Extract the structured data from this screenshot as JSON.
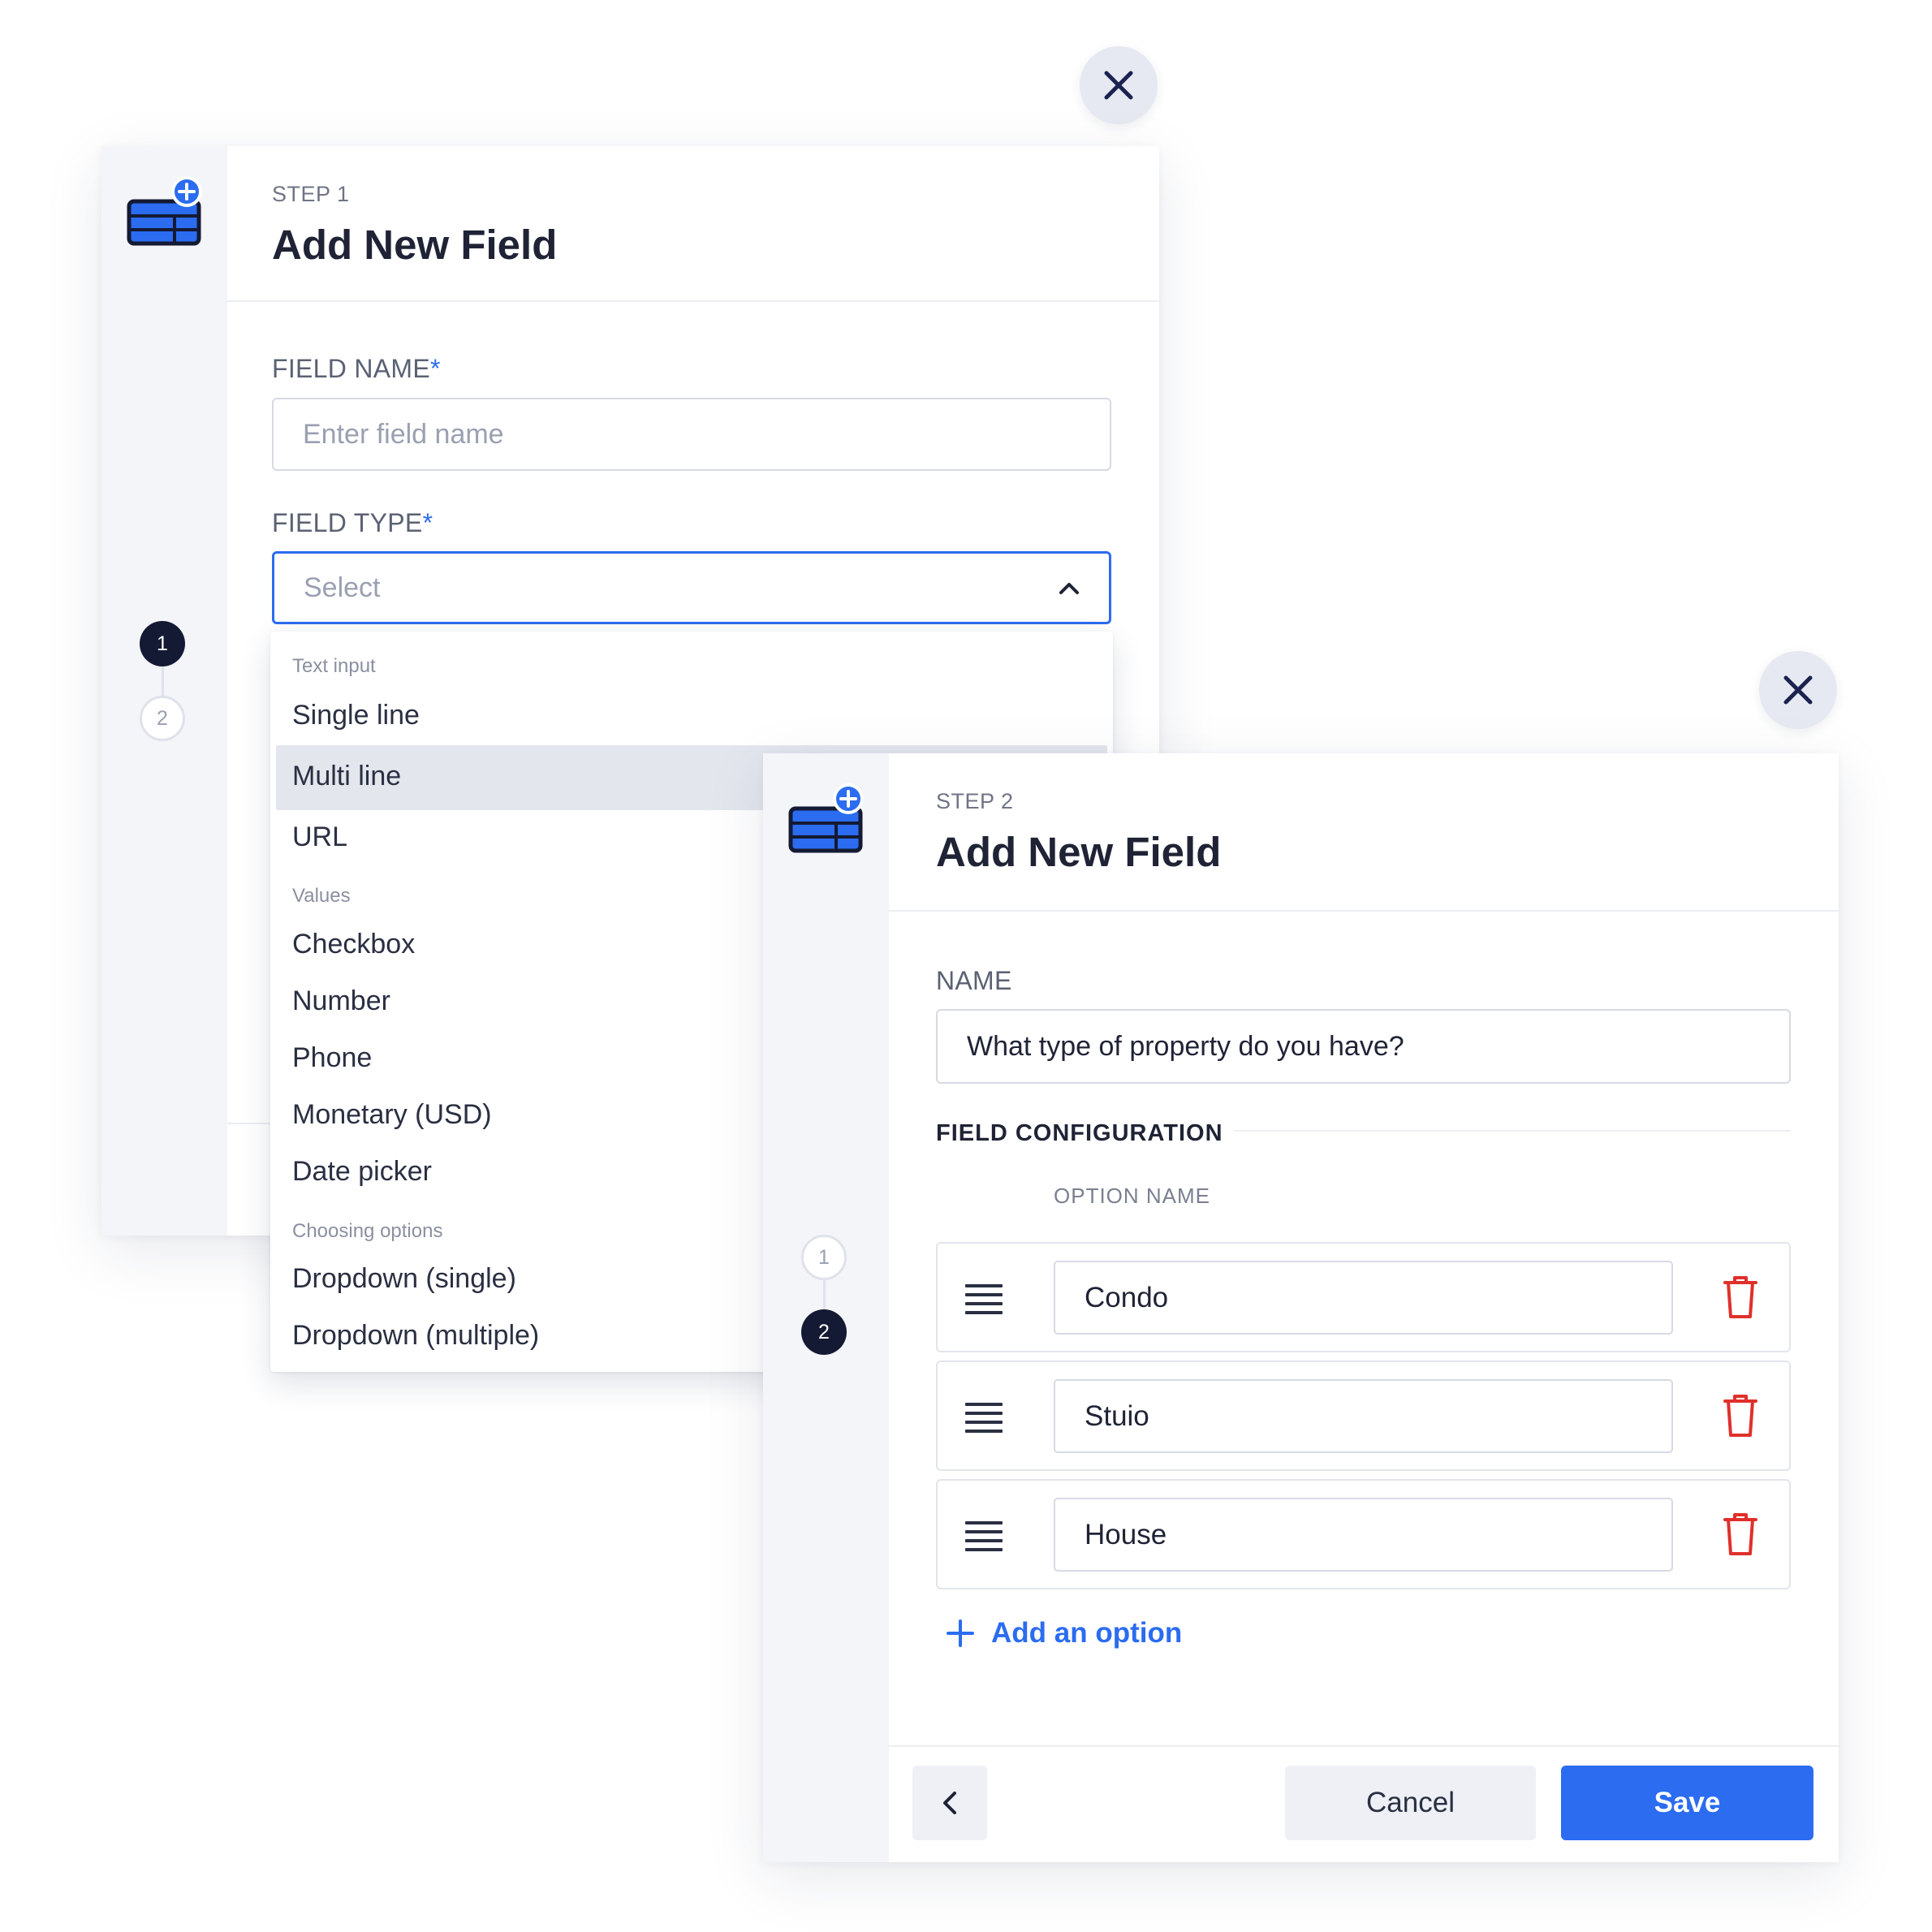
{
  "modal1": {
    "step_label": "STEP 1",
    "title": "Add New Field",
    "steps": [
      "1",
      "2"
    ],
    "field_name": {
      "label": "FIELD NAME",
      "required_mark": "*",
      "placeholder": "Enter field name",
      "value": ""
    },
    "field_type": {
      "label": "FIELD TYPE",
      "required_mark": "*",
      "placeholder": "Select"
    },
    "dropdown": {
      "groups": [
        {
          "label": "Text input",
          "items": [
            "Single line",
            "Multi line",
            "URL"
          ]
        },
        {
          "label": "Values",
          "items": [
            "Checkbox",
            "Number",
            "Phone",
            "Monetary (USD)",
            "Date picker"
          ]
        },
        {
          "label": "Choosing options",
          "items": [
            "Dropdown (single)",
            "Dropdown (multiple)"
          ]
        }
      ],
      "highlighted": "Multi line"
    }
  },
  "modal2": {
    "step_label": "STEP 2",
    "title": "Add New Field",
    "steps": [
      "1",
      "2"
    ],
    "name": {
      "label": "NAME",
      "value": "What type of property do you have?"
    },
    "section_title": "FIELD CONFIGURATION",
    "column_header": "OPTION NAME",
    "options": [
      "Condo",
      "Stuio",
      "House"
    ],
    "add_option_label": "Add an option",
    "buttons": {
      "cancel": "Cancel",
      "save": "Save"
    }
  },
  "colors": {
    "accent": "#2b6cf0",
    "danger": "#e0302b",
    "dark": "#141a33",
    "rail": "#f4f5f9"
  }
}
